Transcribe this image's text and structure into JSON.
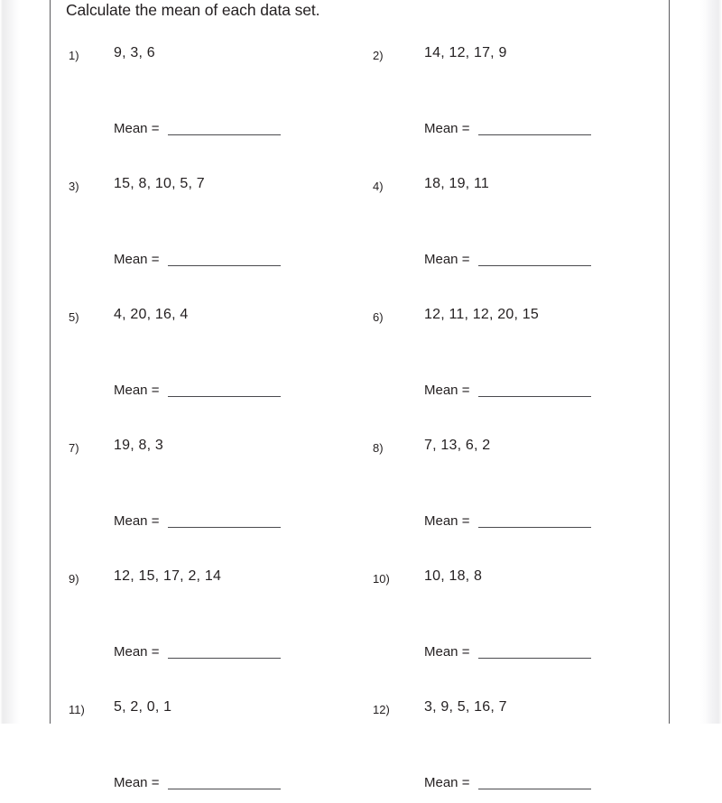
{
  "worksheet": {
    "title": "Calculate the mean of each data set.",
    "mean_label": "Mean  =",
    "answer_placeholder": "",
    "problems": [
      {
        "number": "1)",
        "data": "9,   3,   6"
      },
      {
        "number": "2)",
        "data": "14,   12,   17,   9"
      },
      {
        "number": "3)",
        "data": "15,   8,   10,   5,   7"
      },
      {
        "number": "4)",
        "data": "18,   19,   11"
      },
      {
        "number": "5)",
        "data": "4,   20,   16,   4"
      },
      {
        "number": "6)",
        "data": "12,   11,   12,   20,   15"
      },
      {
        "number": "7)",
        "data": "19,   8,   3"
      },
      {
        "number": "8)",
        "data": "7,   13,   6,   2"
      },
      {
        "number": "9)",
        "data": "12,   15,   17,   2,   14"
      },
      {
        "number": "10)",
        "data": "10,   18,   8"
      },
      {
        "number": "11)",
        "data": "5,   2,   0,   1"
      },
      {
        "number": "12)",
        "data": "3,   9,   5,   16,   7"
      }
    ]
  }
}
